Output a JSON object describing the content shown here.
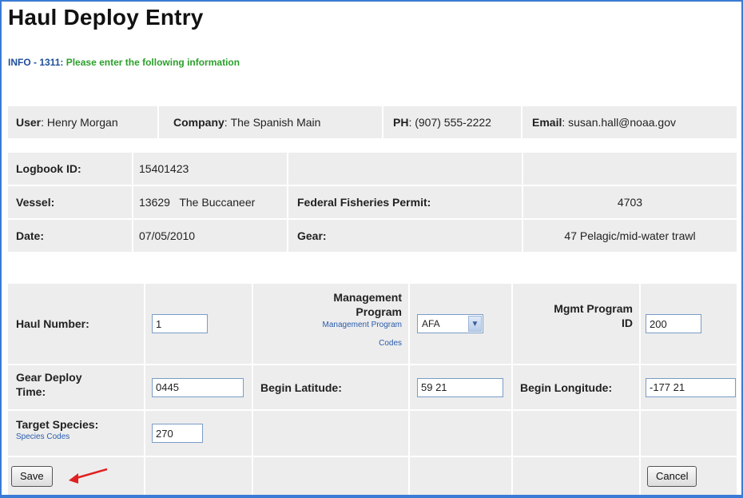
{
  "page": {
    "title": "Haul Deploy Entry",
    "info_code": "INFO - 1311:",
    "info_message": "Please enter the following information"
  },
  "user_bar": {
    "user_label": "User",
    "user_value": "Henry Morgan",
    "company_label": "Company",
    "company_value": "The Spanish Main",
    "phone_label": "PH",
    "phone_value": "(907) 555-2222",
    "email_label": "Email",
    "email_value": "susan.hall@noaa.gov"
  },
  "logbook": {
    "logbook_id_label": "Logbook ID:",
    "logbook_id_value": "15401423",
    "vessel_label": "Vessel:",
    "vessel_value": "13629   The Buccaneer",
    "permit_label": "Federal Fisheries Permit:",
    "permit_value": "4703",
    "date_label": "Date:",
    "date_value": "07/05/2010",
    "gear_label": "Gear:",
    "gear_value": "47 Pelagic/mid-water trawl"
  },
  "form": {
    "haul_number_label": "Haul Number",
    "haul_number_value": "1",
    "mgmt_program_label_1": "Management",
    "mgmt_program_label_2": "Program",
    "mgmt_program_link_1": "Management Program",
    "mgmt_program_link_2": "Codes",
    "mgmt_program_value": "AFA",
    "mgmt_program_id_label_1": "Mgmt Program",
    "mgmt_program_id_label_2": "ID",
    "mgmt_program_id_value": "200",
    "gear_deploy_time_label_1": "Gear Deploy",
    "gear_deploy_time_label_2": "Time",
    "gear_deploy_time_value": "0445",
    "begin_latitude_label": "Begin Latitude",
    "begin_latitude_value": "59 21",
    "begin_longitude_label": "Begin Longitude",
    "begin_longitude_value": "-177 21",
    "target_species_label": "Target Species",
    "species_codes_link": "Species Codes",
    "target_species_value": "270"
  },
  "actions": {
    "save_label": "Save",
    "cancel_label": "Cancel"
  },
  "colors": {
    "frame": "#3a7bd5",
    "info_code": "#1f4e9a",
    "info_message": "#2ba02b",
    "band": "#ededed",
    "arrow": "#e02020"
  }
}
